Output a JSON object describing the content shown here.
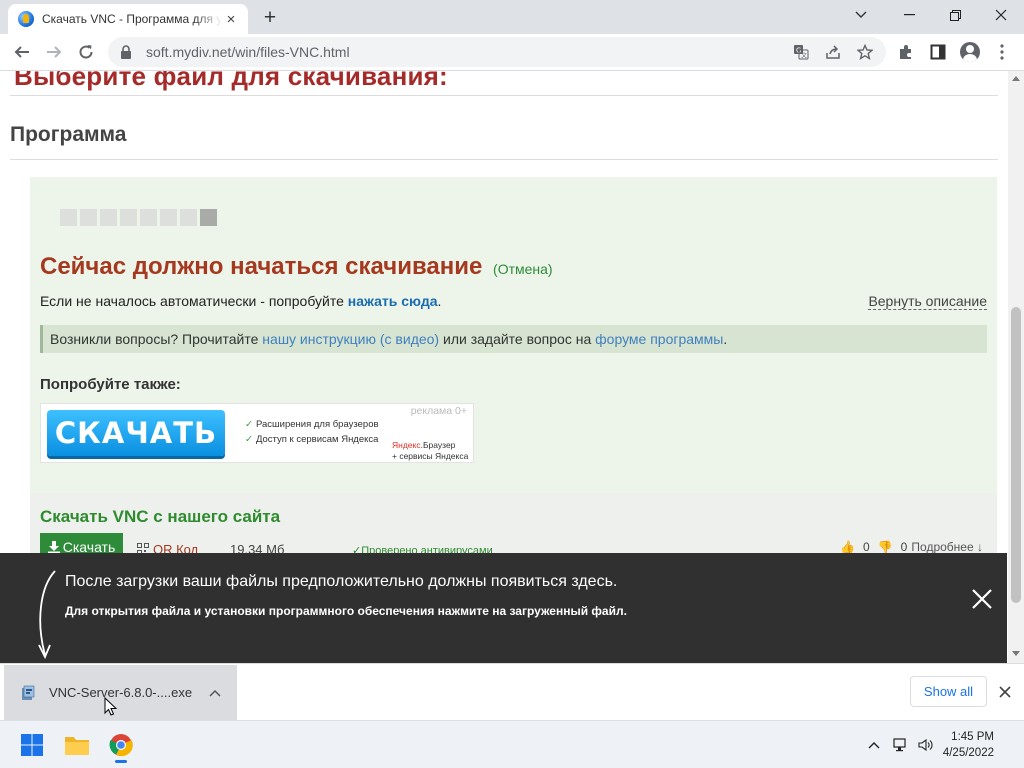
{
  "browser": {
    "tab_title": "Скачать VNC - Программа для удалённого доступа",
    "tab_close": "×",
    "new_tab": "+",
    "url": "soft.mydiv.net/win/files-VNC.html"
  },
  "page": {
    "choose_title": "Выберите файл для скачивания:",
    "program_heading": "Программа",
    "now_downloading": "Сейчас должно начаться скачивание",
    "cancel": "(Отмена)",
    "auto_text": "Если не началось автоматически - попробуйте",
    "click_here": "нажать сюда",
    "auto_period": ".",
    "restore_description": "Вернуть описание",
    "questions_prefix": "Возникли вопросы? Прочитайте",
    "instruction_link": "нашу инструкцию (с видео)",
    "questions_mid": "или задайте вопрос на",
    "forum_link": "форуме программы",
    "questions_end": ".",
    "try_also": "Попробуйте также:",
    "ad": {
      "button": "СКАЧАТЬ",
      "label": "реклама 0+",
      "feature1": "Расширения для браузеров",
      "feature2": "Доступ к сервисам Яндекса",
      "yandex_brand": "Яндекс",
      "yandex_browser_suffix": ".Браузер",
      "yandex_services": "+ сервисы Яндекса"
    },
    "site_download_title": "Скачать VNC с нашего сайта",
    "download_button": "Скачать",
    "qr_code": "QR Код",
    "file_size": "19.34 Мб",
    "virus_checked": "Проверено антивирусами",
    "likes": "0",
    "dislikes": "0",
    "more": "Подробнее ↓"
  },
  "overlay": {
    "line1": "После загрузки ваши файлы предположительно должны появиться здесь.",
    "line2": "Для открытия файла и установки программного обеспечения нажмите на загруженный файл."
  },
  "download_bar": {
    "file_name": "VNC-Server-6.8.0-....exe",
    "show_all": "Show all"
  },
  "taskbar": {
    "time": "1:45 PM",
    "date": "4/25/2022"
  },
  "colors": {
    "heading_red": "#a5391f",
    "green": "#2e8b3a",
    "link_blue": "#1a6cb0",
    "overlay_bg": "#303030",
    "chrome_blue": "#1a73e8"
  },
  "download_progress": {
    "filled_segments": 1,
    "total_segments": 8
  }
}
